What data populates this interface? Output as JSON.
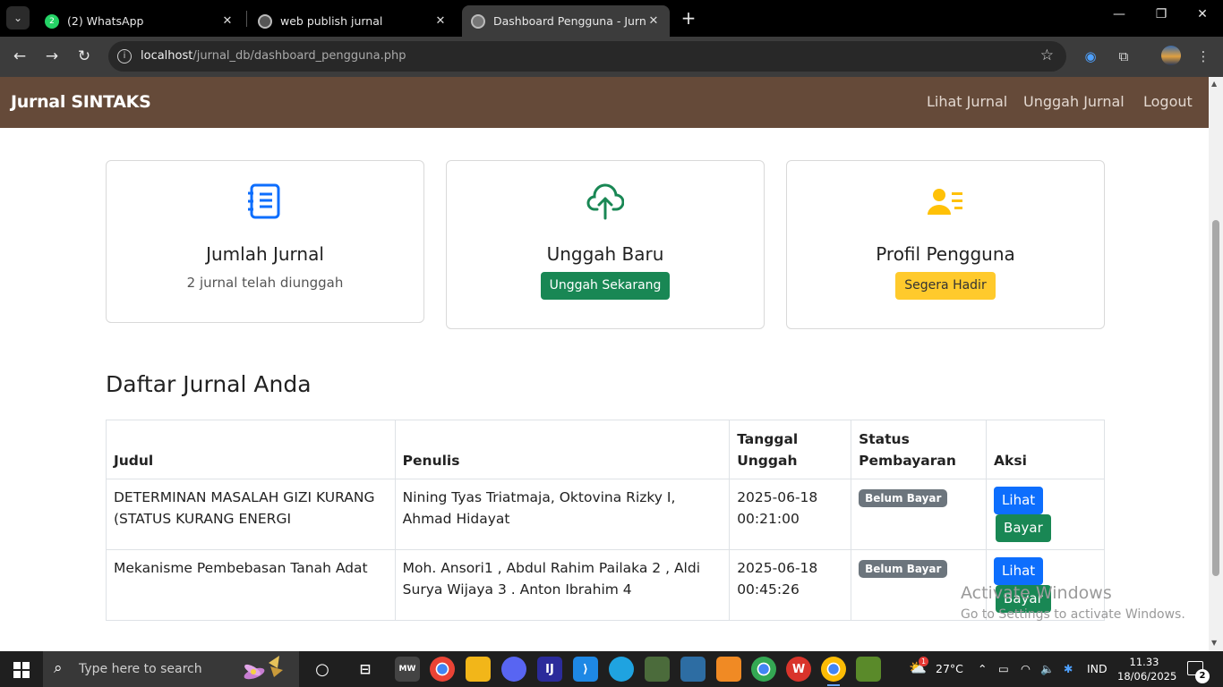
{
  "browser": {
    "tabs": [
      {
        "title": "(2) WhatsApp",
        "badge": "2"
      },
      {
        "title": "web publish jurnal"
      },
      {
        "title": "Dashboard Pengguna - Jurnal S"
      }
    ],
    "url_host": "localhost",
    "url_path": "/jurnal_db/dashboard_pengguna.php"
  },
  "navbar": {
    "brand": "Jurnal SINTAKS",
    "links": [
      "Lihat Jurnal",
      "Unggah Jurnal",
      "Logout"
    ]
  },
  "cards": {
    "jumlah": {
      "title": "Jumlah Jurnal",
      "text": "2 jurnal telah diunggah",
      "icon": "journal-list-icon",
      "color": "#0d6efd"
    },
    "unggah": {
      "title": "Unggah Baru",
      "button": "Unggah Sekarang",
      "icon": "cloud-upload-icon",
      "color": "#198754"
    },
    "profil": {
      "title": "Profil Pengguna",
      "button": "Segera Hadir",
      "icon": "person-lines-icon",
      "color": "#ffc107"
    }
  },
  "section_title": "Daftar Jurnal Anda",
  "table": {
    "headers": {
      "judul": "Judul",
      "penulis": "Penulis",
      "tanggal_1": "Tanggal",
      "tanggal_2": "Unggah",
      "status_1": "Status",
      "status_2": "Pembayaran",
      "aksi": "Aksi"
    },
    "rows": [
      {
        "judul": "DETERMINAN MASALAH GIZI KURANG (STATUS KURANG ENERGI",
        "penulis": "Nining Tyas Triatmaja, Oktovina Rizky I, Ahmad Hidayat",
        "tanggal_date": "2025-06-18",
        "tanggal_time": "00:21:00",
        "status": "Belum Bayar",
        "lihat": "Lihat",
        "bayar": "Bayar"
      },
      {
        "judul": "Mekanisme Pembebasan Tanah Adat",
        "penulis": "Moh. Ansori1 , Abdul Rahim Pailaka 2 , Aldi Surya Wijaya 3 . Anton Ibrahim 4",
        "tanggal_date": "2025-06-18",
        "tanggal_time": "00:45:26",
        "status": "Belum Bayar",
        "lihat": "Lihat",
        "bayar": "Bayar"
      }
    ]
  },
  "watermark": {
    "line1": "Activate Windows",
    "line2": "Go to Settings to activate Windows."
  },
  "taskbar": {
    "search_placeholder": "Type here to search",
    "weather": "27°C",
    "weather_badge": "1",
    "language": "IND",
    "time": "11.33",
    "date": "18/06/2025",
    "notifications": "2"
  }
}
